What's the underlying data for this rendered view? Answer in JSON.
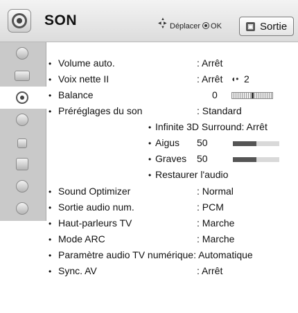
{
  "header": {
    "title": "SON",
    "move_hint": "Déplacer",
    "ok_label": "OK",
    "exit_key": "▣",
    "exit_label": "Sortie"
  },
  "sidebar": {
    "items": [
      {
        "name": "sidebar-item-picture-format",
        "icon": "disc-icon"
      },
      {
        "name": "sidebar-item-picture",
        "icon": "monitor-icon"
      },
      {
        "name": "sidebar-item-sound",
        "icon": "sound-icon",
        "active": true
      },
      {
        "name": "sidebar-item-time",
        "icon": "clock-icon"
      },
      {
        "name": "sidebar-item-lock",
        "icon": "lock-icon"
      },
      {
        "name": "sidebar-item-option",
        "icon": "box-icon"
      },
      {
        "name": "sidebar-item-network",
        "icon": "globe-icon"
      },
      {
        "name": "sidebar-item-support",
        "icon": "help-icon"
      }
    ]
  },
  "menu": {
    "volume_auto": {
      "label": "Volume auto.",
      "value": ": Arrêt"
    },
    "voix_nette": {
      "label": "Voix nette II",
      "value": ": Arrêt",
      "level": "2"
    },
    "balance": {
      "label": "Balance",
      "value": "0"
    },
    "presets": {
      "label": "Préréglages du son",
      "value": ": Standard"
    },
    "surround": {
      "label": "Infinite 3D Surround: Arrêt"
    },
    "aigus": {
      "label": "Aigus",
      "value": "50",
      "level": 0.5
    },
    "graves": {
      "label": "Graves",
      "value": "50",
      "level": 0.5
    },
    "restore": {
      "label": "Restaurer l'audio"
    },
    "sound_optimizer": {
      "label": "Sound Optimizer",
      "value": ": Normal"
    },
    "sortie_audio": {
      "label": "Sortie audio num.",
      "value": ": PCM"
    },
    "haut_parleurs": {
      "label": "Haut-parleurs TV",
      "value": ": Marche"
    },
    "mode_arc": {
      "label": "Mode ARC",
      "value": ": Marche"
    },
    "param_audio": {
      "label": "Paramètre audio TV numérique: Automatique"
    },
    "sync_av": {
      "label": "Sync. AV",
      "value": ": Arrêt"
    },
    "bullet": "•"
  },
  "colors": {
    "bar_fill": "#555555",
    "bar_track": "#d9d9d9",
    "sidebar": "#c9c9c9"
  }
}
